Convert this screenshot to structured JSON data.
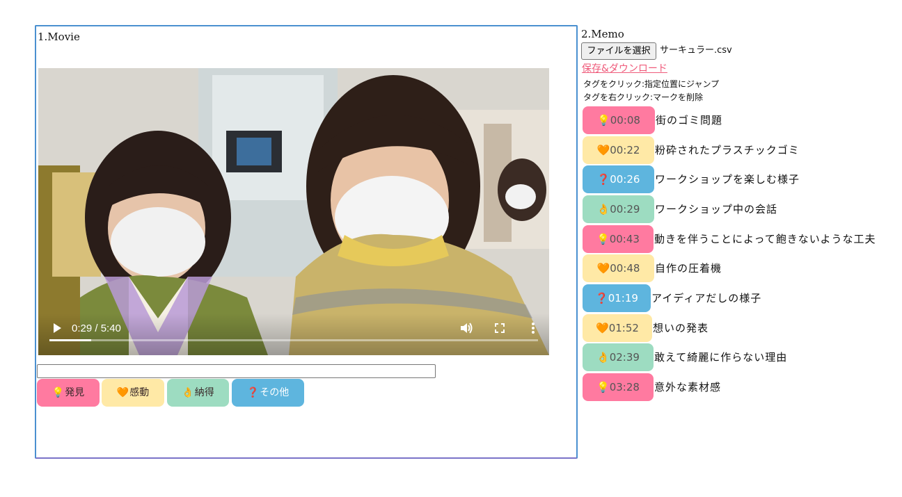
{
  "movie": {
    "title": "1.Movie",
    "video": {
      "current_time": "0:29",
      "duration": "5:40",
      "time_display": "0:29 / 5:40",
      "progress_fraction": 0.085
    },
    "memo_input": {
      "value": "",
      "placeholder": ""
    },
    "tag_buttons": [
      {
        "emoji": "💡",
        "label": "発見",
        "color": "#ff7aa0"
      },
      {
        "emoji": "🧡",
        "label": "感動",
        "color": "#ffe9a6"
      },
      {
        "emoji": "👌",
        "label": "納得",
        "color": "#9ddcc1"
      },
      {
        "emoji": "❓",
        "label": "その他",
        "color": "#5eb5de"
      }
    ]
  },
  "memo": {
    "title": "2.Memo",
    "file_button_label": "ファイルを選択",
    "file_name": "サーキュラー.csv",
    "save_link_label": "保存&ダウンロード",
    "hints": [
      "タグをクリック:指定位置にジャンプ",
      "タグを右クリック:マークを削除"
    ],
    "entries": [
      {
        "emoji": "💡",
        "time": "00:08",
        "text": "街のゴミ問題",
        "color": "#ff7aa0"
      },
      {
        "emoji": "🧡",
        "time": "00:22",
        "text": "粉砕されたプラスチックゴミ",
        "color": "#ffe9a6"
      },
      {
        "emoji": "❓",
        "time": "00:26",
        "text": "ワークショップを楽しむ様子",
        "color": "#5eb5de"
      },
      {
        "emoji": "👌",
        "time": "00:29",
        "text": "ワークショップ中の会話",
        "color": "#9ddcc1"
      },
      {
        "emoji": "💡",
        "time": "00:43",
        "text": "動きを伴うことによって飽きないような工夫",
        "color": "#ff7aa0"
      },
      {
        "emoji": "🧡",
        "time": "00:48",
        "text": "自作の圧着機",
        "color": "#ffe9a6"
      },
      {
        "emoji": "❓",
        "time": "01:19",
        "text": "アイディアだしの様子",
        "color": "#5eb5de"
      },
      {
        "emoji": "🧡",
        "time": "01:52",
        "text": "想いの発表",
        "color": "#ffe9a6"
      },
      {
        "emoji": "👌",
        "time": "02:39",
        "text": "敢えて綺麗に作らない理由",
        "color": "#9ddcc1"
      },
      {
        "emoji": "💡",
        "time": "03:28",
        "text": "意外な素材感",
        "color": "#ff7aa0"
      }
    ]
  }
}
